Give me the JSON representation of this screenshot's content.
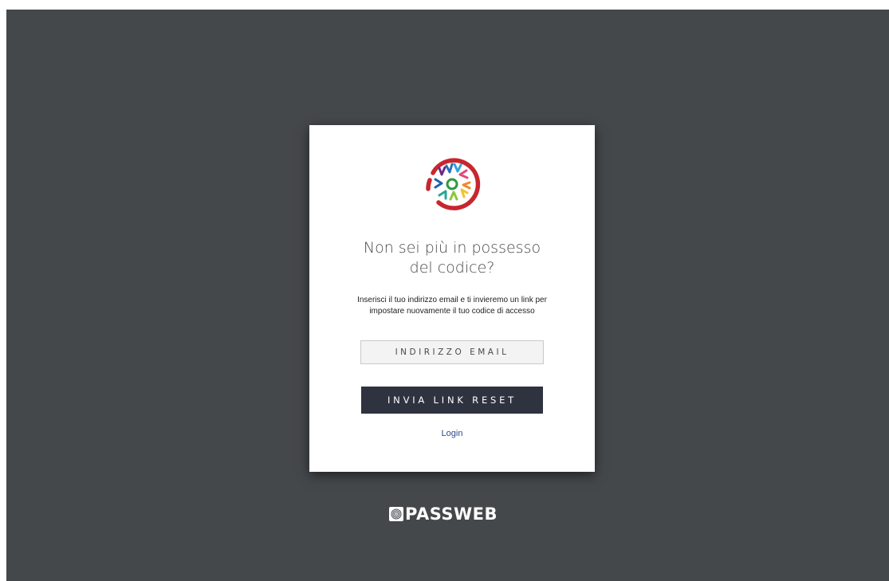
{
  "reset_form": {
    "title_line1": "Non sei più in possesso",
    "title_line2": "del codice?",
    "description": "Inserisci il tuo indirizzo email e ti invieremo un link per impostare nuovamente il tuo codice di accesso",
    "email_placeholder": "INDIRIZZO EMAIL",
    "submit_label": "INVIA LINK RESET",
    "login_link": "Login"
  },
  "footer": {
    "brand_name": "PASSWEB"
  },
  "icons": {
    "logo": "sunburst-logo-icon",
    "brand": "fingerprint-icon"
  },
  "colors": {
    "background": "#45484b",
    "card": "#ffffff",
    "button": "#2f3340",
    "link": "#2d4a8a",
    "logo_ring": "#c8262f"
  }
}
